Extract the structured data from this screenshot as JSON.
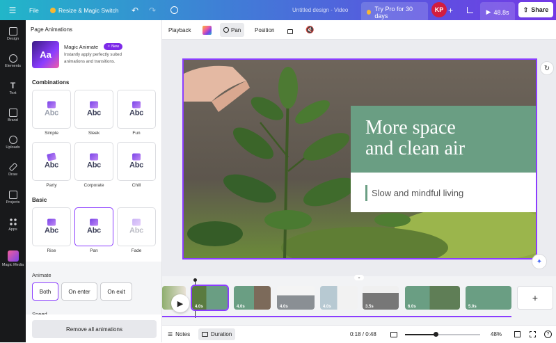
{
  "topbar": {
    "file": "File",
    "resize": "Resize & Magic Switch",
    "doc_title": "Untitled design - Video",
    "try_pro": "Try Pro for 30 days",
    "avatar": "KP",
    "duration": "48.8s",
    "share": "Share"
  },
  "sidebar": {
    "items": [
      {
        "label": "Design",
        "icon": "design-icon"
      },
      {
        "label": "Elements",
        "icon": "elements-icon"
      },
      {
        "label": "Text",
        "icon": "text-icon"
      },
      {
        "label": "Brand",
        "icon": "brand-icon"
      },
      {
        "label": "Uploads",
        "icon": "uploads-icon"
      },
      {
        "label": "Draw",
        "icon": "draw-icon"
      },
      {
        "label": "Projects",
        "icon": "projects-icon"
      },
      {
        "label": "Apps",
        "icon": "apps-icon"
      },
      {
        "label": "Magic Media",
        "icon": "magic-media-icon"
      }
    ]
  },
  "panel": {
    "title": "Page Animations",
    "magic": {
      "title": "Magic Animate",
      "badge": "New",
      "desc_line1": "Instantly apply perfectly suited",
      "desc_line2": "animations and transitions."
    },
    "combinations_heading": "Combinations",
    "combinations": [
      "Simple",
      "Sleek",
      "Fun",
      "Party",
      "Corporate",
      "Chill"
    ],
    "basic_heading": "Basic",
    "basic": [
      "Rise",
      "Pan",
      "Fade"
    ],
    "basic_selected": "Pan",
    "card_text": "Abc",
    "animate_heading": "Animate",
    "animate_options": [
      "Both",
      "On enter",
      "On exit"
    ],
    "animate_selected": "Both",
    "speed_heading": "Speed",
    "remove_all": "Remove all animations"
  },
  "toolbar": {
    "playback": "Playback",
    "pan": "Pan",
    "position": "Position"
  },
  "design": {
    "headline_line1": "More space",
    "headline_line2": "and clean air",
    "subtitle": "Slow and mindful living",
    "accent_color": "#6a9e83",
    "selection_color": "#8b3dff"
  },
  "timeline": {
    "clips": [
      "4.0s",
      "4.0s",
      "4.0s",
      "4.0s",
      "3.5s",
      "6.0s",
      "5.0s"
    ]
  },
  "bottombar": {
    "notes": "Notes",
    "duration": "Duration",
    "time": "0:18 / 0:48",
    "zoom": "48%"
  }
}
